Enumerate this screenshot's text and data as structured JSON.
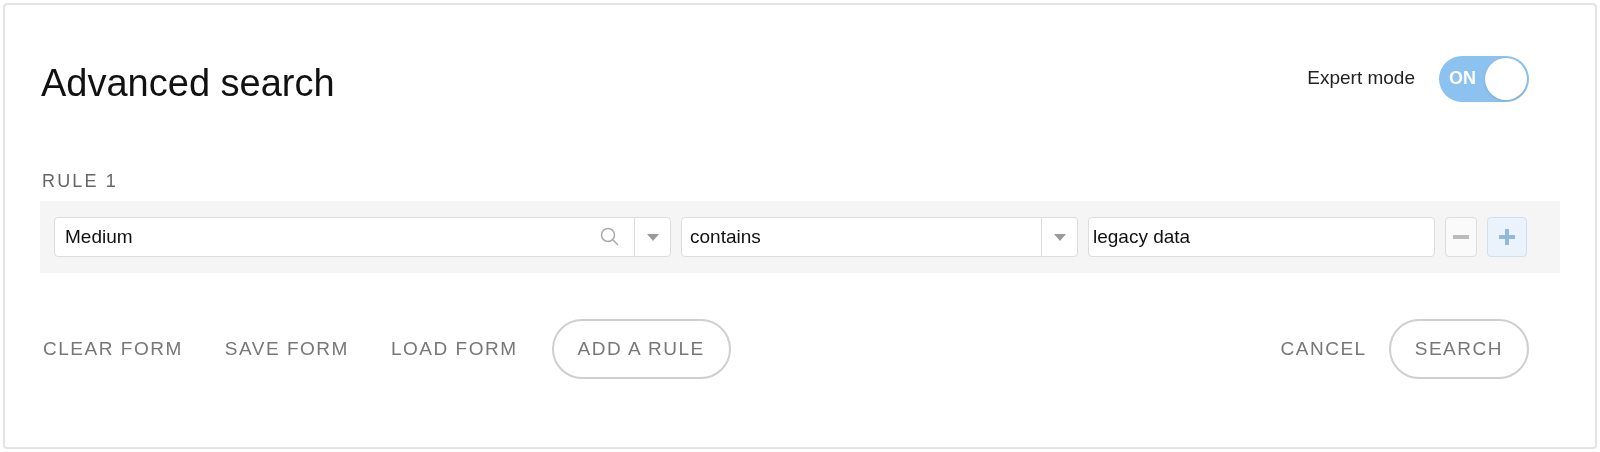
{
  "title": "Advanced search",
  "expert_mode": {
    "label": "Expert mode",
    "on": true,
    "state_label": "ON"
  },
  "rules": [
    {
      "label": "RULE 1",
      "field": "Medium",
      "operator": "contains",
      "value": "legacy data"
    }
  ],
  "left_actions": [
    {
      "label": "CLEAR FORM",
      "kind": "text"
    },
    {
      "label": "SAVE FORM",
      "kind": "text"
    },
    {
      "label": "LOAD FORM",
      "kind": "text"
    },
    {
      "label": "ADD A RULE",
      "kind": "outline"
    }
  ],
  "right_actions": [
    {
      "label": "CANCEL",
      "kind": "text"
    },
    {
      "label": "SEARCH",
      "kind": "outline"
    }
  ]
}
